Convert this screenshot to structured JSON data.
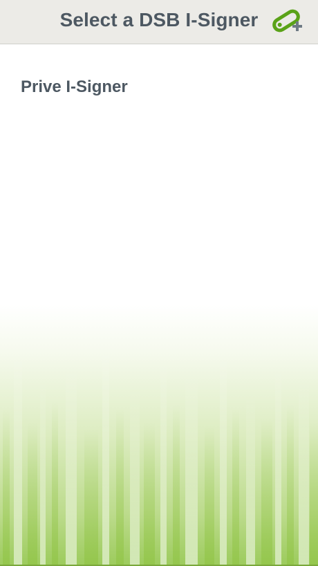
{
  "header": {
    "title": "Select a DSB I-Signer",
    "add_icon": "key-plus-icon"
  },
  "signers": [
    {
      "label": "Prive I-Signer"
    }
  ],
  "background": {
    "icon": "grass-gradient",
    "accent_color": "#8dc23f",
    "light_color": "#e6f2d2"
  },
  "colors": {
    "header_bg": "#ecebe7",
    "text": "#4d5862",
    "icon_green": "#5aa218",
    "icon_plus": "#6e7a84"
  }
}
